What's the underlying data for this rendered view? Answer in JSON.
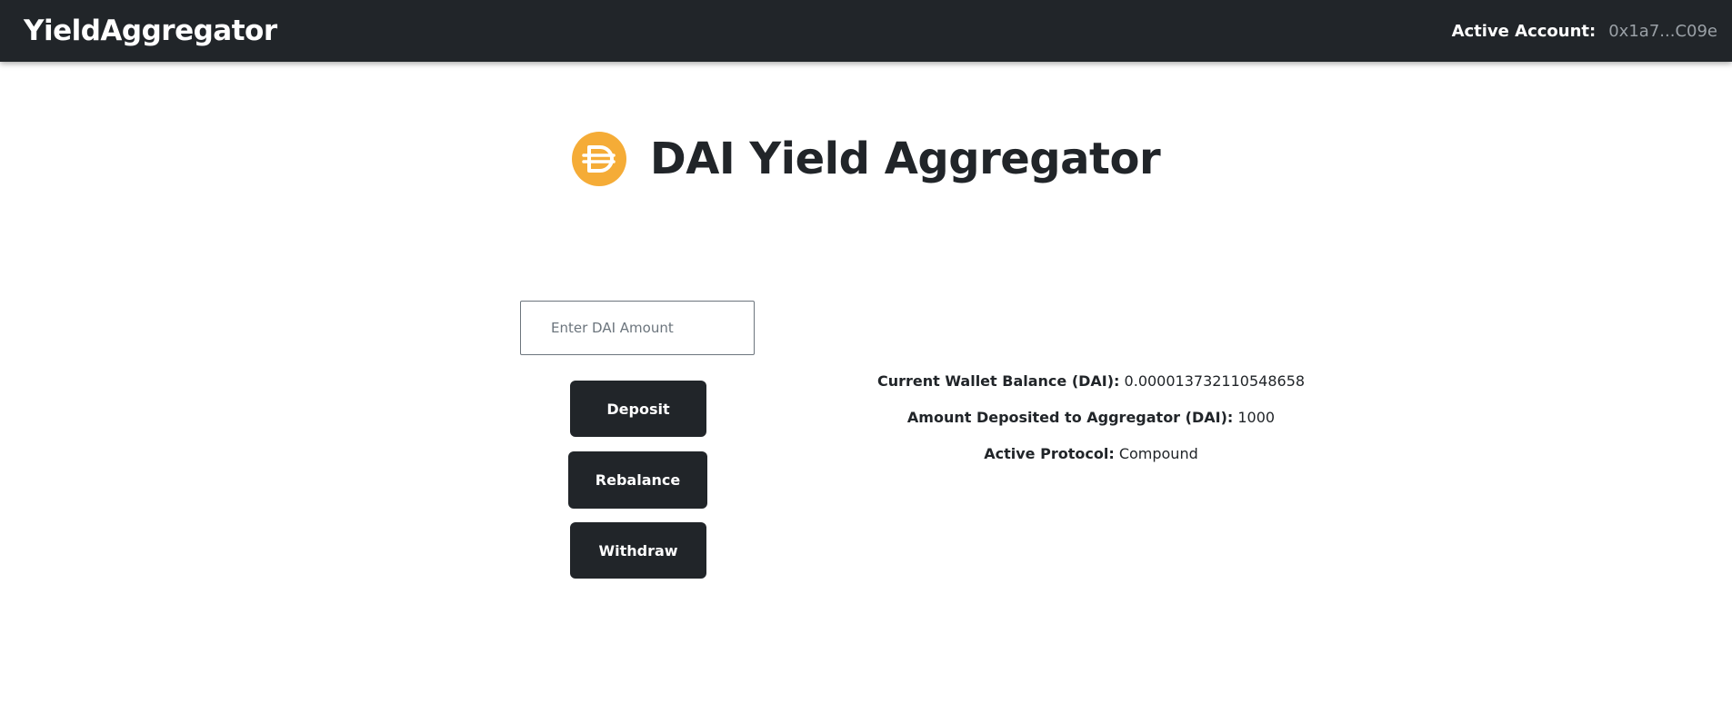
{
  "navbar": {
    "brand": "YieldAggregator",
    "account_label": "Active Account:",
    "account_value": "0x1a7...C09e"
  },
  "hero": {
    "logo_icon": "dai-logo-icon",
    "title": "DAI Yield Aggregator"
  },
  "form": {
    "amount_placeholder": "Enter DAI Amount",
    "amount_value": "",
    "deposit_label": "Deposit",
    "rebalance_label": "Rebalance",
    "withdraw_label": "Withdraw"
  },
  "stats": {
    "wallet_balance_label": "Current Wallet Balance (DAI):",
    "wallet_balance_value": "0.000013732110548658",
    "deposited_label": "Amount Deposited to Aggregator (DAI):",
    "deposited_value": "1000",
    "protocol_label": "Active Protocol:",
    "protocol_value": "Compound"
  },
  "colors": {
    "navbar_bg": "#212529",
    "button_bg": "#212529",
    "dai_orange": "#F5AC37",
    "account_value": "#9aa0a6"
  }
}
